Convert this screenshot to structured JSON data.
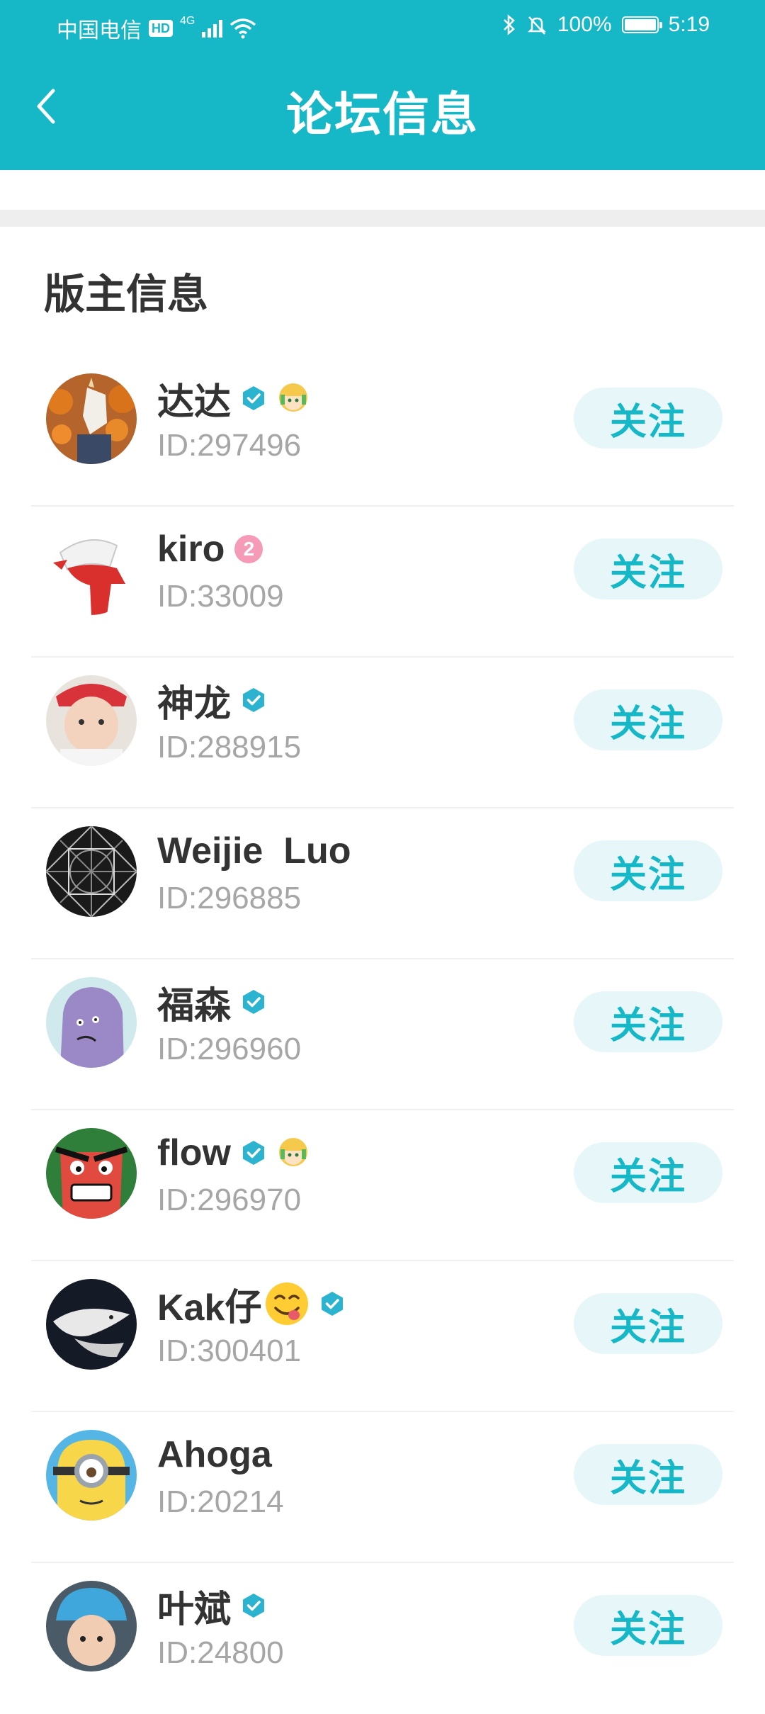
{
  "status_bar": {
    "carrier": "中国电信",
    "hd": "HD",
    "network": "4G",
    "battery": "100%",
    "time": "5:19"
  },
  "header": {
    "title": "论坛信息"
  },
  "section": {
    "title": "版主信息"
  },
  "colors": {
    "primary": "#16b8c8",
    "follow_bg": "#e7f7f9",
    "id_grey": "#a6a6a6"
  },
  "moderators": [
    {
      "name": "达达",
      "id": "ID:297496",
      "verified": true,
      "medal": true,
      "follow": "关注",
      "avatar": "unicorn-mask-photo"
    },
    {
      "name": "kiro",
      "id": "ID:33009",
      "level": "2",
      "follow": "关注",
      "avatar": "red-scarf-illustration"
    },
    {
      "name": "神龙",
      "id": "ID:288915",
      "verified": true,
      "follow": "关注",
      "avatar": "baby-photo"
    },
    {
      "name": "Weijie  Luo",
      "id": "ID:296885",
      "follow": "关注",
      "avatar": "glass-dome-photo"
    },
    {
      "name": "福森",
      "id": "ID:296960",
      "verified": true,
      "follow": "关注",
      "avatar": "purple-blob-illustration"
    },
    {
      "name": "flow",
      "id": "ID:296970",
      "verified": true,
      "medal": true,
      "follow": "关注",
      "avatar": "angry-cartoon"
    },
    {
      "name": "Kak仔",
      "id": "ID:300401",
      "verified": true,
      "emoji": "yum-emoji",
      "follow": "关注",
      "avatar": "shark-photo"
    },
    {
      "name": "Ahoga",
      "id": "ID:20214",
      "follow": "关注",
      "avatar": "minion"
    },
    {
      "name": "叶斌",
      "id": "ID:24800",
      "verified": true,
      "follow": "关注",
      "avatar": "helmet-kid-photo"
    }
  ]
}
